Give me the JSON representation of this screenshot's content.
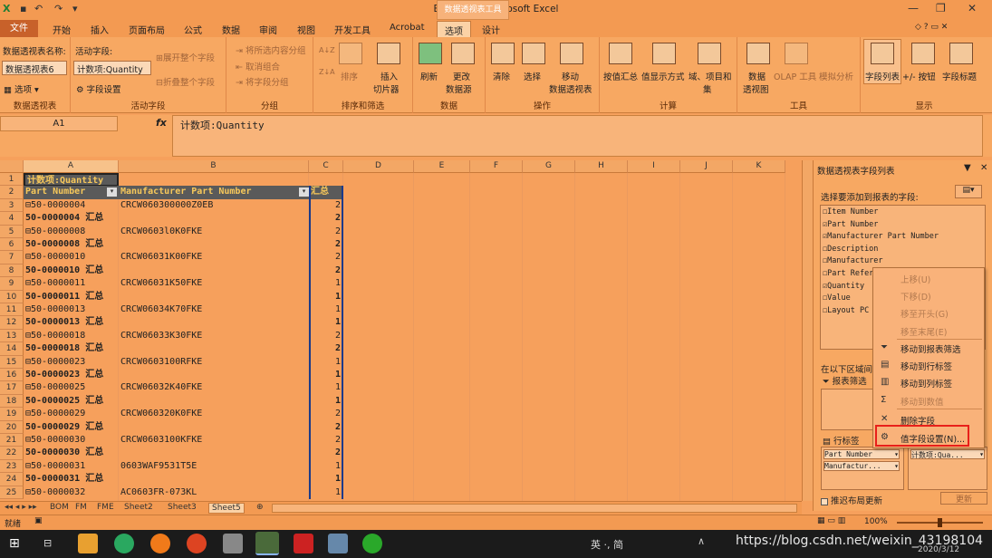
{
  "window": {
    "title": "BOM.xlsx - Microsoft Excel",
    "context_tab_group": "数据透视表工具"
  },
  "tabs": [
    "文件",
    "开始",
    "插入",
    "页面布局",
    "公式",
    "数据",
    "审阅",
    "视图",
    "开发工具",
    "Acrobat",
    "选项",
    "设计"
  ],
  "ribbon": {
    "pivot": {
      "name_label": "数据透视表名称:",
      "name_value": "数据透视表6",
      "options": "选项",
      "group": "数据透视表"
    },
    "active_field": {
      "label": "活动字段:",
      "value": "计数项:Quantity",
      "field_settings": "字段设置",
      "expand": "展开整个字段",
      "collapse": "折叠整个字段",
      "group": "活动字段"
    },
    "grouping": {
      "group_selection": "将所选内容分组",
      "ungroup": "取消组合",
      "group_field": "将字段分组",
      "group": "分组"
    },
    "sort": {
      "az": "A↓Z",
      "za": "Z↓A",
      "sort": "排序",
      "insert_slicer": "插入",
      "slicer": "切片器",
      "group": "排序和筛选"
    },
    "data": {
      "refresh": "刷新",
      "change_source": "更改",
      "source": "数据源",
      "group": "数据"
    },
    "actions": {
      "clear": "清除",
      "select": "选择",
      "move": "移动",
      "move2": "数据透视表",
      "group": "操作"
    },
    "calc": {
      "summarize": "按值汇总",
      "show_as": "值显示方式",
      "fields": "域、项目和",
      "fields2": "集",
      "group": "计算"
    },
    "tools": {
      "pivotchart": "数据",
      "pivotchart2": "透视图",
      "olap": "OLAP 工具",
      "whatif": "模拟分析",
      "group": "工具"
    },
    "show": {
      "field_list": "字段列表",
      "buttons": "+/- 按钮",
      "headers": "字段标题",
      "group": "显示"
    }
  },
  "formula": {
    "namebox": "A1",
    "fx": "fx",
    "value": "计数项:Quantity"
  },
  "columns": [
    "A",
    "B",
    "C",
    "D",
    "E",
    "F",
    "G",
    "H",
    "I",
    "J",
    "K"
  ],
  "rows": [
    {
      "n": "1",
      "a": "计数项:Quantity",
      "b": "",
      "c": ""
    },
    {
      "n": "2",
      "a": "Part Number",
      "b": "Manufacturer Part Number",
      "c": "汇总"
    },
    {
      "n": "3",
      "a": "⊟50-0000004",
      "b": "CRCW060300000Z0EB",
      "c": "2"
    },
    {
      "n": "4",
      "a": "50-0000004 汇总",
      "b": "",
      "c": "2"
    },
    {
      "n": "5",
      "a": "⊟50-0000008",
      "b": "CRCW0603l0K0FKE",
      "c": "2"
    },
    {
      "n": "6",
      "a": "50-0000008 汇总",
      "b": "",
      "c": "2"
    },
    {
      "n": "7",
      "a": "⊟50-0000010",
      "b": "CRCW06031K00FKE",
      "c": "2"
    },
    {
      "n": "8",
      "a": "50-0000010 汇总",
      "b": "",
      "c": "2"
    },
    {
      "n": "9",
      "a": "⊟50-0000011",
      "b": "CRCW06031K50FKE",
      "c": "1"
    },
    {
      "n": "10",
      "a": "50-0000011 汇总",
      "b": "",
      "c": "1"
    },
    {
      "n": "11",
      "a": "⊟50-0000013",
      "b": "CRCW06034K70FKE",
      "c": "1"
    },
    {
      "n": "12",
      "a": "50-0000013 汇总",
      "b": "",
      "c": "1"
    },
    {
      "n": "13",
      "a": "⊟50-0000018",
      "b": "CRCW06033K30FKE",
      "c": "2"
    },
    {
      "n": "14",
      "a": "50-0000018 汇总",
      "b": "",
      "c": "2"
    },
    {
      "n": "15",
      "a": "⊟50-0000023",
      "b": "CRCW0603100RFKE",
      "c": "1"
    },
    {
      "n": "16",
      "a": "50-0000023 汇总",
      "b": "",
      "c": "1"
    },
    {
      "n": "17",
      "a": "⊟50-0000025",
      "b": "CRCW06032K40FKE",
      "c": "1"
    },
    {
      "n": "18",
      "a": "50-0000025 汇总",
      "b": "",
      "c": "1"
    },
    {
      "n": "19",
      "a": "⊟50-0000029",
      "b": "CRCW060320K0FKE",
      "c": "2"
    },
    {
      "n": "20",
      "a": "50-0000029 汇总",
      "b": "",
      "c": "2"
    },
    {
      "n": "21",
      "a": "⊟50-0000030",
      "b": "CRCW0603100KFKE",
      "c": "2"
    },
    {
      "n": "22",
      "a": "50-0000030 汇总",
      "b": "",
      "c": "2"
    },
    {
      "n": "23",
      "a": "⊟50-0000031",
      "b": "0603WAF9531T5E",
      "c": "1"
    },
    {
      "n": "24",
      "a": "50-0000031 汇总",
      "b": "",
      "c": "1"
    },
    {
      "n": "25",
      "a": "⊟50-0000032",
      "b": "AC0603FR-073KL",
      "c": "1"
    }
  ],
  "sheets": [
    "BOM",
    "FM",
    "FME",
    "Sheet2",
    "Sheet3",
    "Sheet5"
  ],
  "panel": {
    "title": "数据透视表字段列表",
    "choose": "选择要添加到报表的字段:",
    "fields": [
      {
        "name": "Item Number",
        "checked": "☐"
      },
      {
        "name": "Part Number",
        "checked": "☑"
      },
      {
        "name": "Manufacturer Part Number",
        "checked": "☑"
      },
      {
        "name": "Description",
        "checked": "☐"
      },
      {
        "name": "Manufacturer",
        "checked": "☐"
      },
      {
        "name": "Part Refer",
        "checked": "☐"
      },
      {
        "name": "Quantity",
        "checked": "☑"
      },
      {
        "name": "Value",
        "checked": "☐"
      },
      {
        "name": "Layout PC",
        "checked": "☐"
      }
    ],
    "drag_areas": "在以下区域间",
    "report_filter": "报表筛选",
    "row_labels": "行标签",
    "row_fields": [
      "Part Number",
      "Manufactur..."
    ],
    "value_field": "计数项:Qua...",
    "defer": "推迟布局更新",
    "update": "更新"
  },
  "context_menu": [
    {
      "icon": "",
      "label": "上移(U)",
      "dim": true
    },
    {
      "icon": "",
      "label": "下移(D)",
      "dim": true
    },
    {
      "icon": "",
      "label": "移至开头(G)",
      "dim": true
    },
    {
      "icon": "",
      "label": "移至末尾(E)",
      "dim": true
    },
    {
      "icon": "⏷",
      "label": "移动到报表筛选",
      "dim": false
    },
    {
      "icon": "▤",
      "label": "移动到行标签",
      "dim": false
    },
    {
      "icon": "▥",
      "label": "移动到列标签",
      "dim": false
    },
    {
      "icon": "Σ",
      "label": "移动到数值",
      "dim": true
    },
    {
      "icon": "✕",
      "label": "删除字段",
      "dim": false
    },
    {
      "icon": "⚙",
      "label": "值字段设置(N)...",
      "dim": false
    }
  ],
  "status": {
    "ready": "就绪",
    "zoom": "100%"
  },
  "taskbar": {
    "ime": "英 ·, 简",
    "watermark": "https://blog.csdn.net/weixin_43198104",
    "date": "2020/3/12"
  },
  "colors": {
    "highlight": "#e8201a",
    "header_dark": "#5a5a5a"
  }
}
